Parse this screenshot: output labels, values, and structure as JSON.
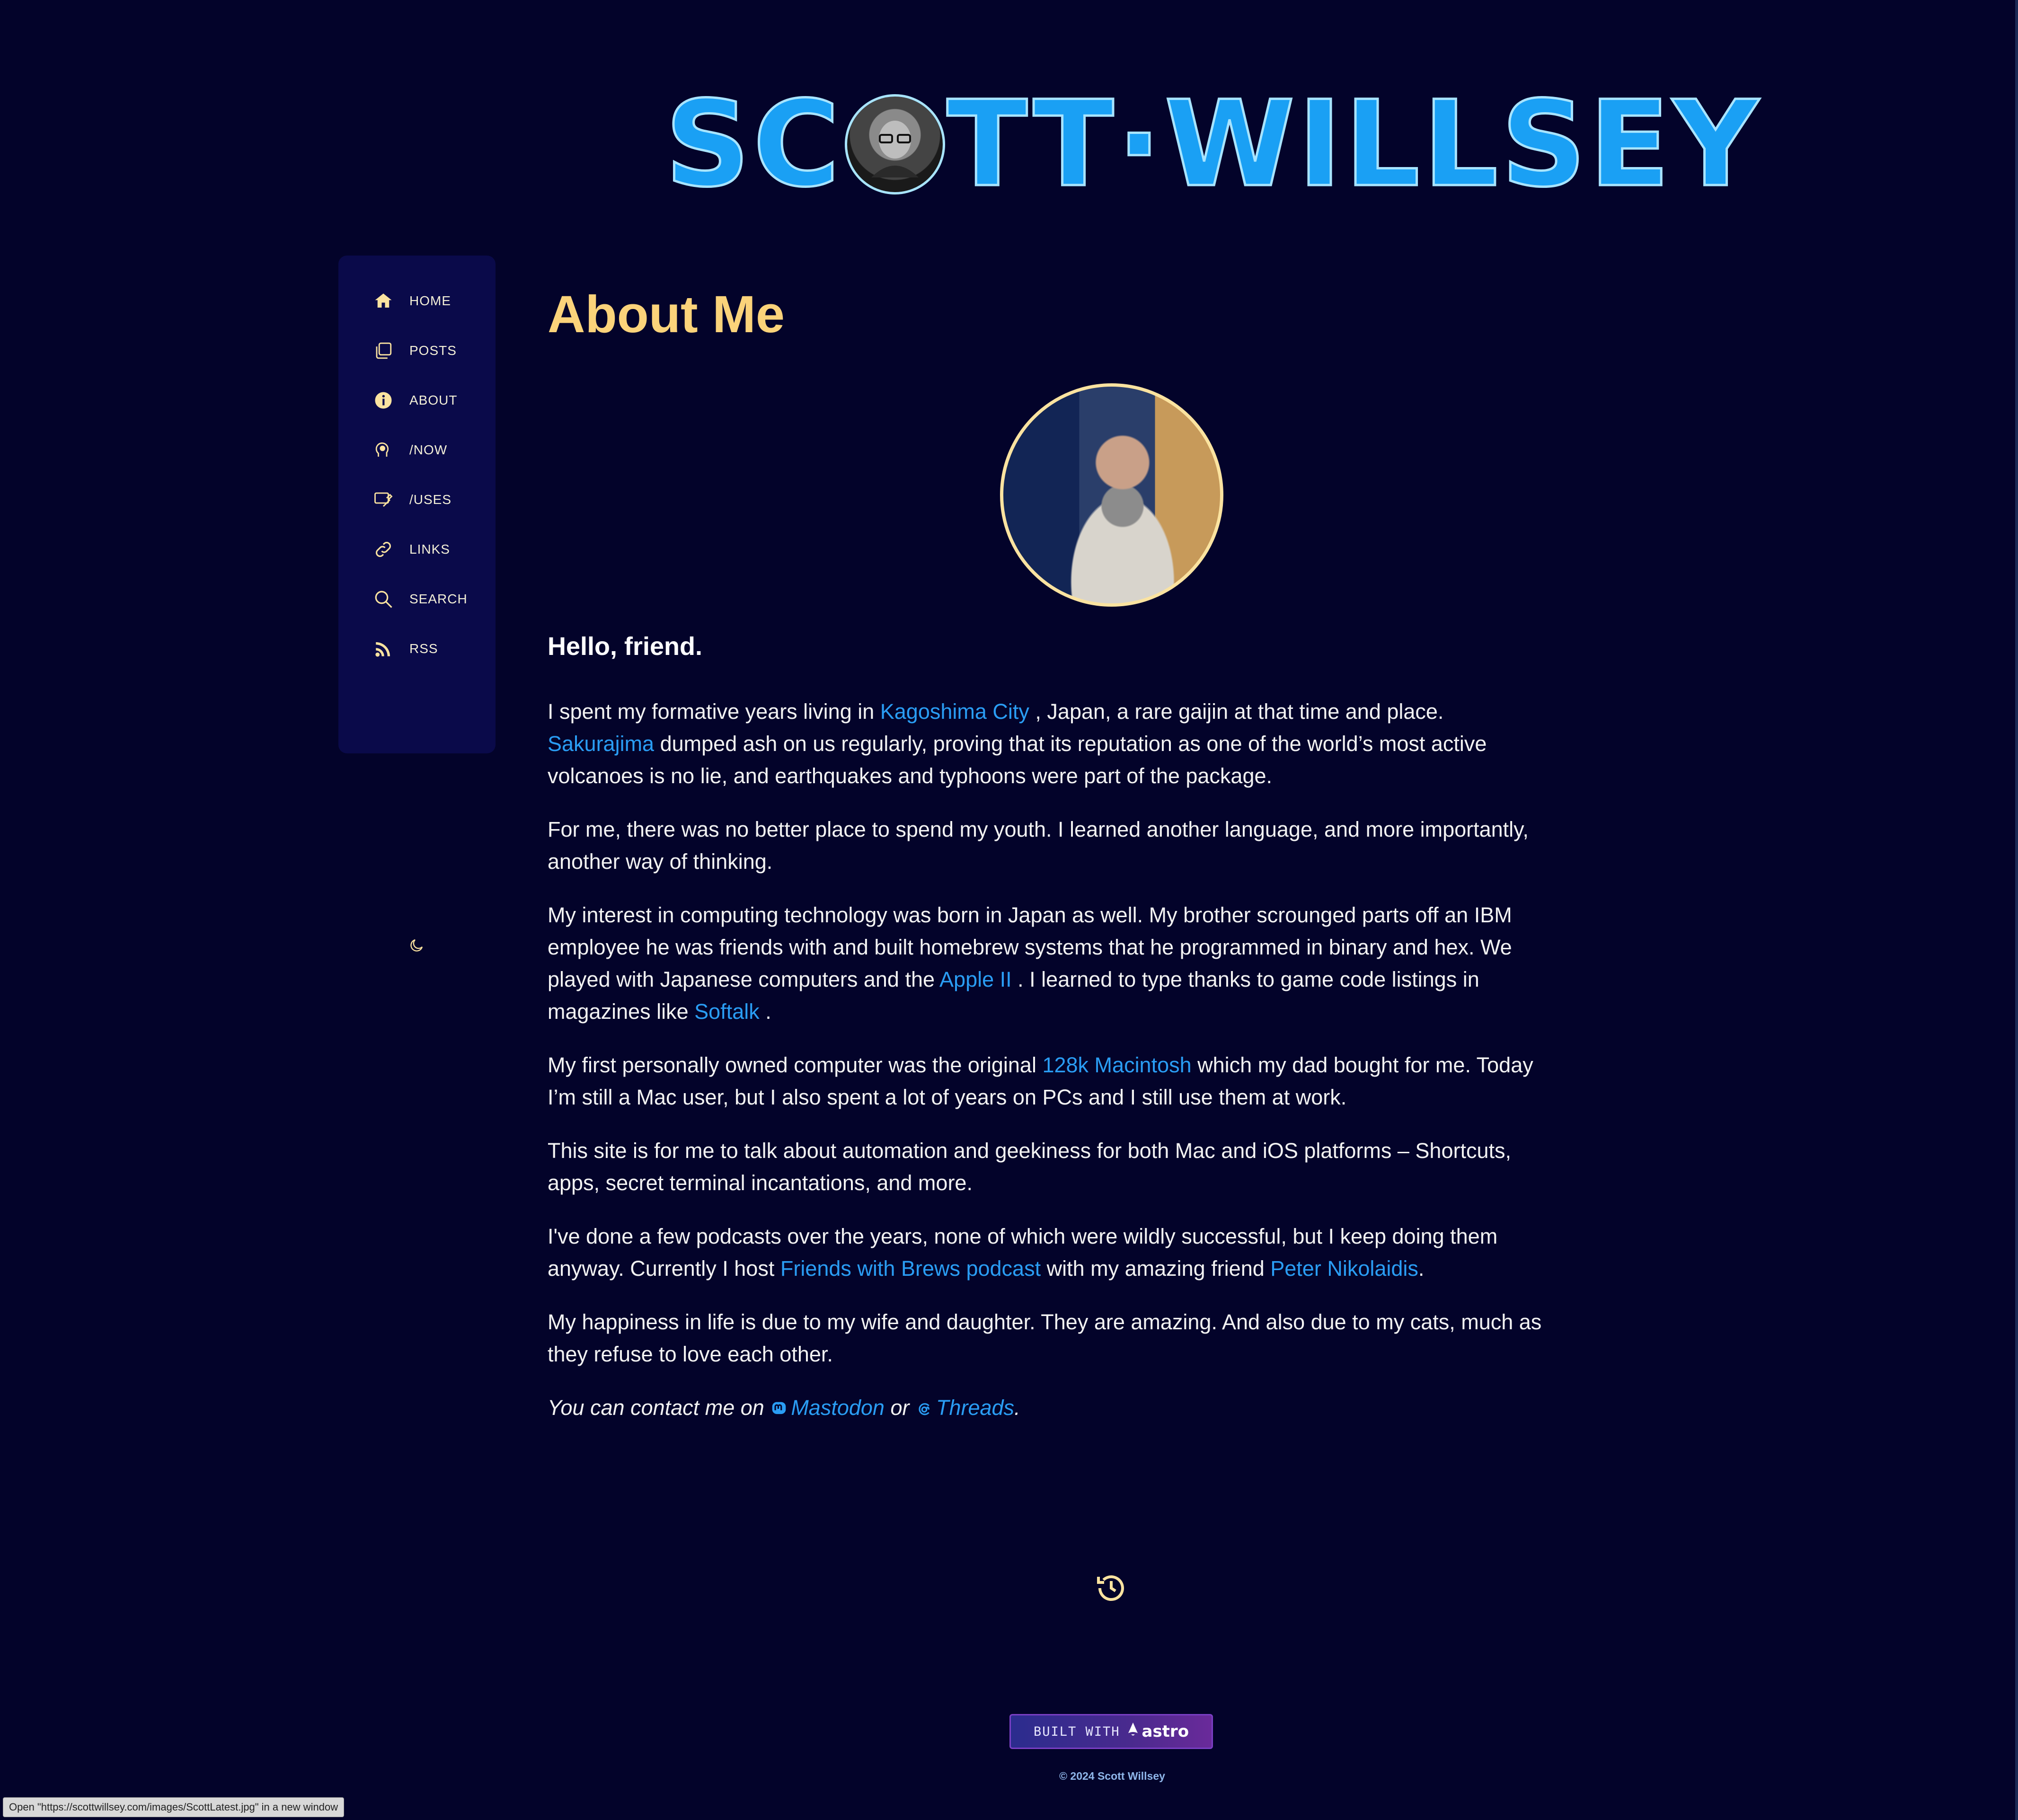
{
  "header": {
    "logo_left": "SC",
    "logo_right": "TT·WILLSEY"
  },
  "sidebar": {
    "items": [
      {
        "label": "HOME",
        "icon": "home-icon"
      },
      {
        "label": "POSTS",
        "icon": "posts-icon"
      },
      {
        "label": "ABOUT",
        "icon": "info-icon"
      },
      {
        "label": "/NOW",
        "icon": "now-icon"
      },
      {
        "label": "/USES",
        "icon": "uses-icon"
      },
      {
        "label": "LINKS",
        "icon": "link-icon"
      },
      {
        "label": "SEARCH",
        "icon": "search-icon"
      },
      {
        "label": "RSS",
        "icon": "rss-icon"
      }
    ],
    "theme_toggle_icon": "moon-icon"
  },
  "main": {
    "title": "About Me",
    "greeting": "Hello, friend.",
    "p1": {
      "t1": "I spent my formative years living in ",
      "link1": "Kagoshima City",
      "t2": " , Japan, a rare gaijin at that time and place. ",
      "link2": "Sakurajima",
      "t3": " dumped ash on us regularly, proving that its reputation as one of the world’s most active volcanoes is no lie, and earthquakes and typhoons were part of the package."
    },
    "p2": "For me, there was no better place to spend my youth. I learned another language, and more importantly, another way of thinking.",
    "p3": {
      "t1": "My interest in computing technology was born in Japan as well. My brother scrounged parts off an IBM employee he was friends with and built homebrew systems that he programmed in binary and hex. We played with Japanese computers and the ",
      "link1": "Apple II",
      "t2": " . I learned to type thanks to game code listings in magazines like ",
      "link2": "Softalk",
      "t3": " ."
    },
    "p4": {
      "t1": "My first personally owned computer was the original ",
      "link1": "128k Macintosh",
      "t2": " which my dad bought for me. Today I’m still a Mac user, but I also spent a lot of years on PCs and I still use them at work."
    },
    "p5": "This site is for me to talk about automation and geekiness for both Mac and iOS platforms – Shortcuts, apps, secret terminal incantations, and more.",
    "p6": {
      "t1": "I've done a few podcasts over the years, none of which were wildly successful, but I keep doing them anyway. Currently I host ",
      "link1": "Friends with Brews podcast",
      "t2": " with my amazing friend ",
      "link2": "Peter Nikolaidis",
      "t3": "."
    },
    "p7": "My happiness in life is due to my wife and daughter. They are amazing. And also due to my cats, much as they refuse to love each other.",
    "contact": {
      "t1": "You can contact me on ",
      "mastodon": "Mastodon",
      "t2": " or ",
      "threads": "Threads",
      "t3": "."
    }
  },
  "footer": {
    "built_with": "BUILT WITH",
    "astro": "astro",
    "copyright": "© 2024 Scott Willsey"
  },
  "status_bar": "Open \"https://scottwillsey.com/images/ScottLatest.jpg\" in a new window",
  "colors": {
    "background": "#03032a",
    "sidebar": "#0a0a4a",
    "title": "#fbd37a",
    "link": "#2a9df4",
    "logo": "#1aa0f4"
  }
}
